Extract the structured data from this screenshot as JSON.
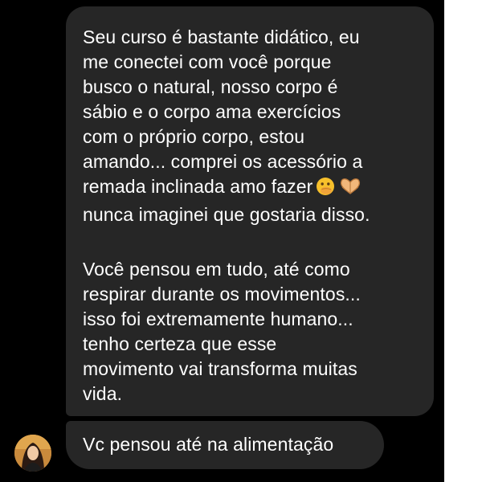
{
  "messages": [
    {
      "paragraphs": [
        [
          "Seu curso é bastante didático, eu",
          "me conectei com você porque",
          "busco o natural, nosso corpo é",
          "sábio e o corpo ama exercícios",
          "com o próprio corpo, estou",
          "amando... comprei os acessório a",
          "remada inclinada amo fazer",
          "nunca imaginei que gostaria disso."
        ],
        [
          "Você pensou em tudo, até como",
          "respirar durante os movimentos...",
          "isso foi extremamente humano...",
          "tenho certeza que esse",
          "movimento vai transforma muitas",
          "vida."
        ]
      ],
      "emojis": [
        "face-with-hand-over-mouth-icon",
        "heart-hands-icon"
      ]
    },
    {
      "text": "Vc pensou até na alimentação"
    }
  ],
  "colors": {
    "background": "#000000",
    "bubble": "#262626",
    "text": "#ffffff"
  }
}
